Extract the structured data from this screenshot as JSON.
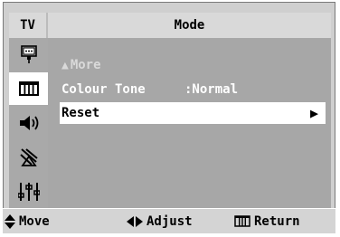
{
  "header": {
    "tv_tab": "TV",
    "title": "Mode"
  },
  "sidebar": {
    "items": [
      {
        "icon": "input-icon",
        "active": false
      },
      {
        "icon": "picture-icon",
        "active": true
      },
      {
        "icon": "sound-icon",
        "active": false
      },
      {
        "icon": "channel-icon",
        "active": false
      },
      {
        "icon": "setup-icon",
        "active": false
      }
    ]
  },
  "menu": {
    "more_label": "More",
    "colour_tone_label": "Colour Tone",
    "colour_tone_value": ":Normal",
    "reset_label": "Reset"
  },
  "footer": {
    "move_label": "Move",
    "adjust_label": "Adjust",
    "return_label": "Return"
  },
  "colors": {
    "background": "#a7a7a7",
    "highlight": "#ffffff",
    "sidebar": "#a9a9a9",
    "header": "#d9d9d9"
  }
}
